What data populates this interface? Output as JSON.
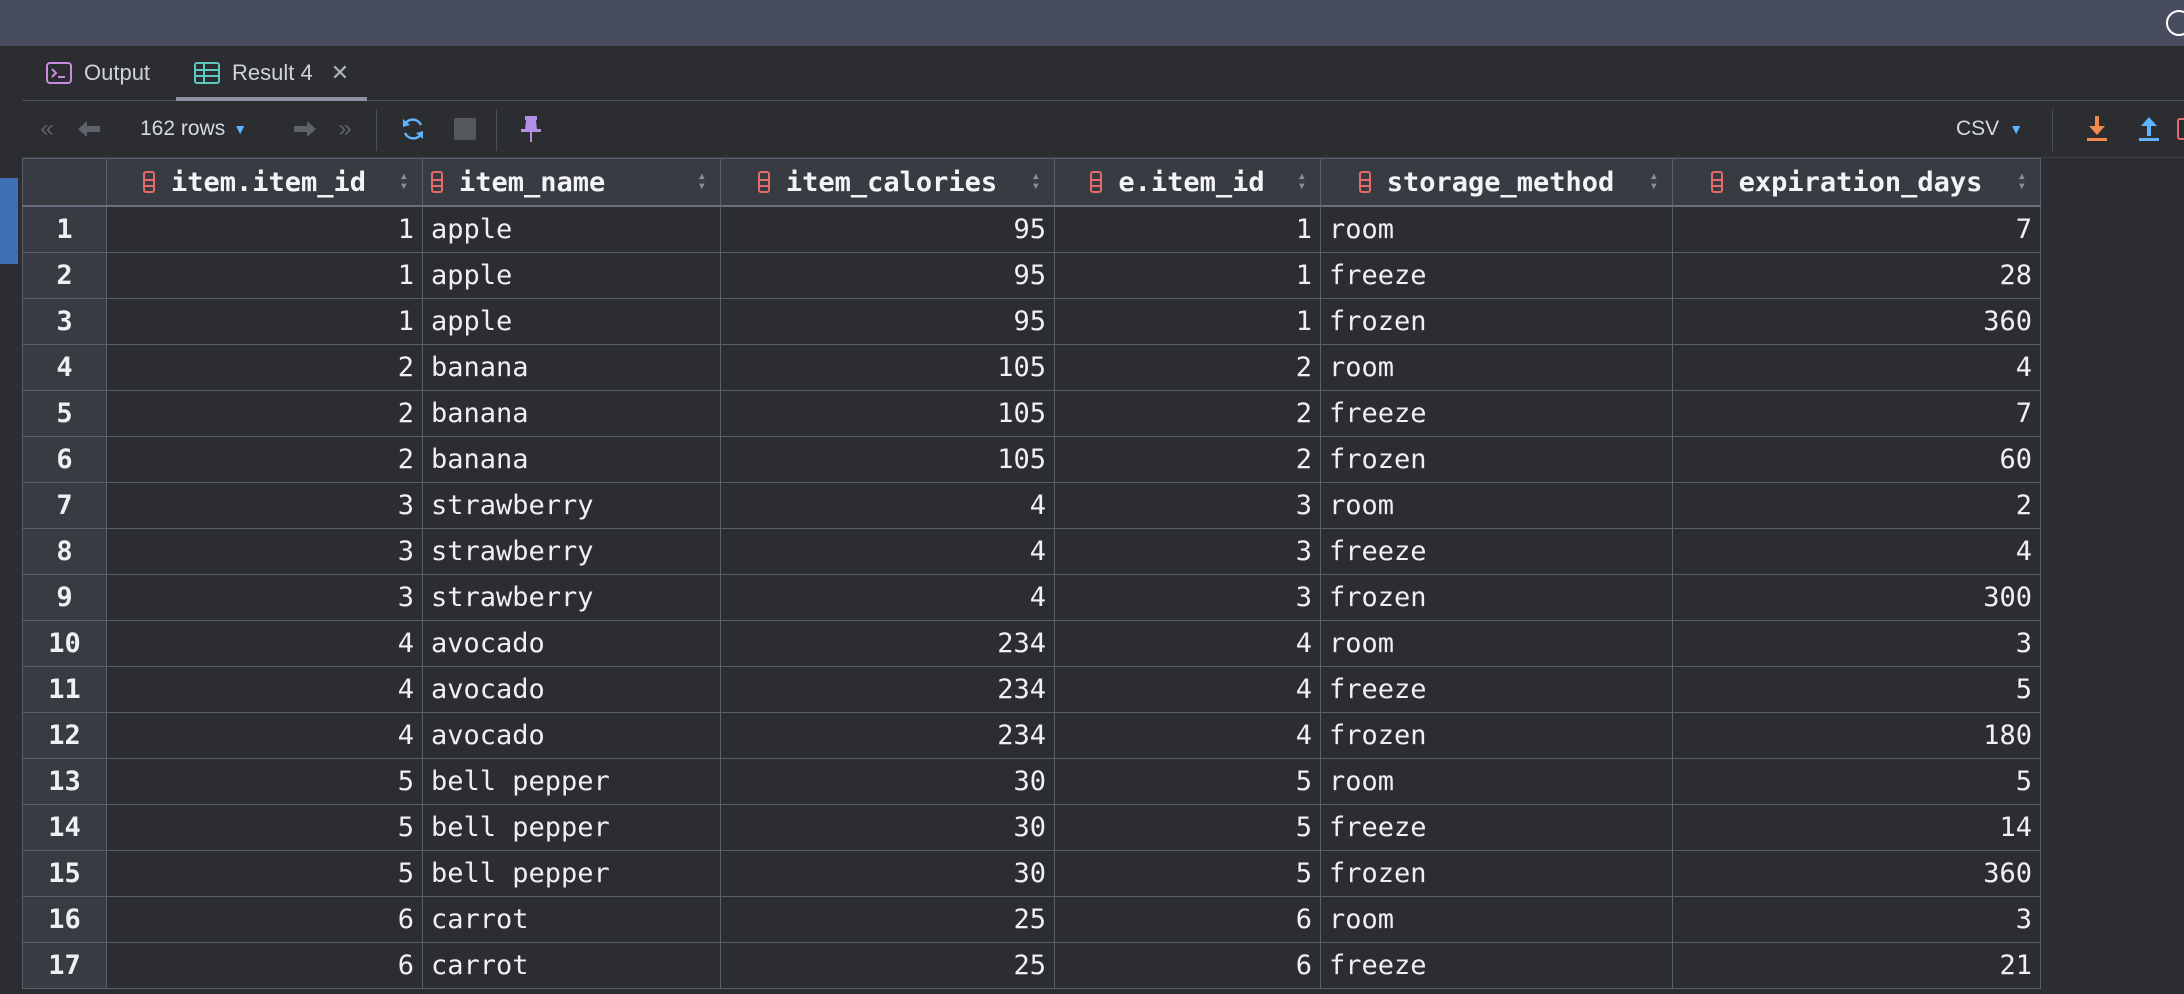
{
  "tabs": [
    {
      "label": "Output"
    },
    {
      "label": "Result 4"
    }
  ],
  "toolbar": {
    "rows_label": "162 rows",
    "export_format": "CSV"
  },
  "table": {
    "columns": [
      "item.item_id",
      "item_name",
      "item_calories",
      "e.item_id",
      "storage_method",
      "expiration_days"
    ],
    "rows": [
      [
        "1",
        "1",
        "apple",
        "95",
        "1",
        "room",
        "7"
      ],
      [
        "2",
        "1",
        "apple",
        "95",
        "1",
        "freeze",
        "28"
      ],
      [
        "3",
        "1",
        "apple",
        "95",
        "1",
        "frozen",
        "360"
      ],
      [
        "4",
        "2",
        "banana",
        "105",
        "2",
        "room",
        "4"
      ],
      [
        "5",
        "2",
        "banana",
        "105",
        "2",
        "freeze",
        "7"
      ],
      [
        "6",
        "2",
        "banana",
        "105",
        "2",
        "frozen",
        "60"
      ],
      [
        "7",
        "3",
        "strawberry",
        "4",
        "3",
        "room",
        "2"
      ],
      [
        "8",
        "3",
        "strawberry",
        "4",
        "3",
        "freeze",
        "4"
      ],
      [
        "9",
        "3",
        "strawberry",
        "4",
        "3",
        "frozen",
        "300"
      ],
      [
        "10",
        "4",
        "avocado",
        "234",
        "4",
        "room",
        "3"
      ],
      [
        "11",
        "4",
        "avocado",
        "234",
        "4",
        "freeze",
        "5"
      ],
      [
        "12",
        "4",
        "avocado",
        "234",
        "4",
        "frozen",
        "180"
      ],
      [
        "13",
        "5",
        "bell pepper",
        "30",
        "5",
        "room",
        "5"
      ],
      [
        "14",
        "5",
        "bell pepper",
        "30",
        "5",
        "freeze",
        "14"
      ],
      [
        "15",
        "5",
        "bell pepper",
        "30",
        "5",
        "frozen",
        "360"
      ],
      [
        "16",
        "6",
        "carrot",
        "25",
        "6",
        "room",
        "3"
      ],
      [
        "17",
        "6",
        "carrot",
        "25",
        "6",
        "freeze",
        "21"
      ]
    ]
  },
  "icons": {
    "output_tab": "console-icon",
    "result_tab": "table-icon",
    "column": "column-icon"
  },
  "colors": {
    "accent_blue": "#5fb3ff",
    "column_icon": "#e46b6b",
    "pin": "#b58ee6",
    "export_orange": "#f08a4b"
  }
}
